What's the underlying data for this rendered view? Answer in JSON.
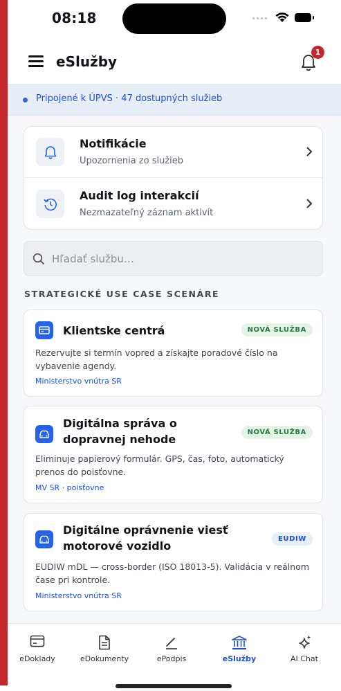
{
  "status": {
    "time": "08:18"
  },
  "header": {
    "title": "eSlužby",
    "notification_count": "1"
  },
  "banner": {
    "text": "Pripojené k ÚPVS · 47 dostupných služieb"
  },
  "quick_actions": [
    {
      "title": "Notifikácie",
      "subtitle": "Upozornenia zo služieb",
      "icon": "bell-icon"
    },
    {
      "title": "Audit log interakcií",
      "subtitle": "Nezmazateľný záznam aktivít",
      "icon": "history-icon"
    }
  ],
  "search": {
    "placeholder": "Hľadať službu…"
  },
  "section": {
    "heading": "STRATEGICKÉ USE CASE SCENÁRE"
  },
  "services": [
    {
      "title": "Klientske centrá",
      "tag": "NOVÁ SLUŽBA",
      "description": "Rezervujte si termín vopred a získajte poradové číslo na vybavenie agendy.",
      "ministry": "Ministerstvo vnútra SR",
      "icon": "id-card-icon"
    },
    {
      "title": "Digitálna správa o dopravnej nehode",
      "tag": "NOVÁ SLUŽBA",
      "description": "Eliminuje papierový formulár. GPS, čas, foto, automatický prenos do poisťovne.",
      "ministry": "MV SR · poisťovne",
      "icon": "car-icon"
    },
    {
      "title": "Digitálne oprávnenie viesť motorové vozidlo",
      "tag": "EUDIW",
      "description": "EUDIW mDL — cross-border (ISO 18013-5). Validácia v reálnom čase pri kontrole.",
      "ministry": "Ministerstvo vnútra SR",
      "icon": "car-icon"
    }
  ],
  "nav": [
    {
      "label": "eDoklady",
      "icon": "wallet-card-icon",
      "active": false
    },
    {
      "label": "eDokumenty",
      "icon": "document-icon",
      "active": false
    },
    {
      "label": "ePodpis",
      "icon": "pen-icon",
      "active": false
    },
    {
      "label": "eSlužby",
      "icon": "bank-icon",
      "active": true
    },
    {
      "label": "AI Chat",
      "icon": "sparkle-icon",
      "active": false
    }
  ],
  "colors": {
    "accent": "#1d4ed8",
    "brand_red": "#c1272d",
    "new_tag": "#257a3e"
  }
}
